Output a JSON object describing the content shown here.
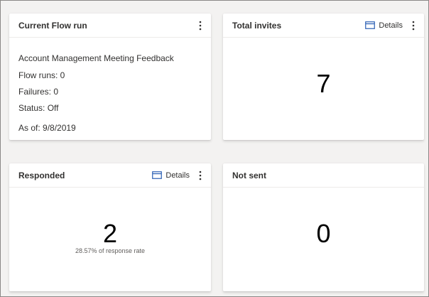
{
  "cards": {
    "flow_run": {
      "title": "Current Flow run",
      "flow_name": "Account Management Meeting Feedback",
      "flow_runs": "Flow runs: 0",
      "failures": "Failures: 0",
      "status": "Status: Off",
      "as_of": "As of: 9/8/2019"
    },
    "total_invites": {
      "title": "Total invites",
      "details_label": "Details",
      "value": "7"
    },
    "responded": {
      "title": "Responded",
      "details_label": "Details",
      "value": "2",
      "caption": "28.57% of response rate"
    },
    "not_sent": {
      "title": "Not sent",
      "value": "0"
    }
  },
  "colors": {
    "background": "#f3f2f1",
    "card": "#ffffff",
    "details_icon": "#2b5fb4",
    "text": "#323130"
  },
  "icons": {
    "more": "more-vertical-icon",
    "details": "details-panel-icon"
  }
}
